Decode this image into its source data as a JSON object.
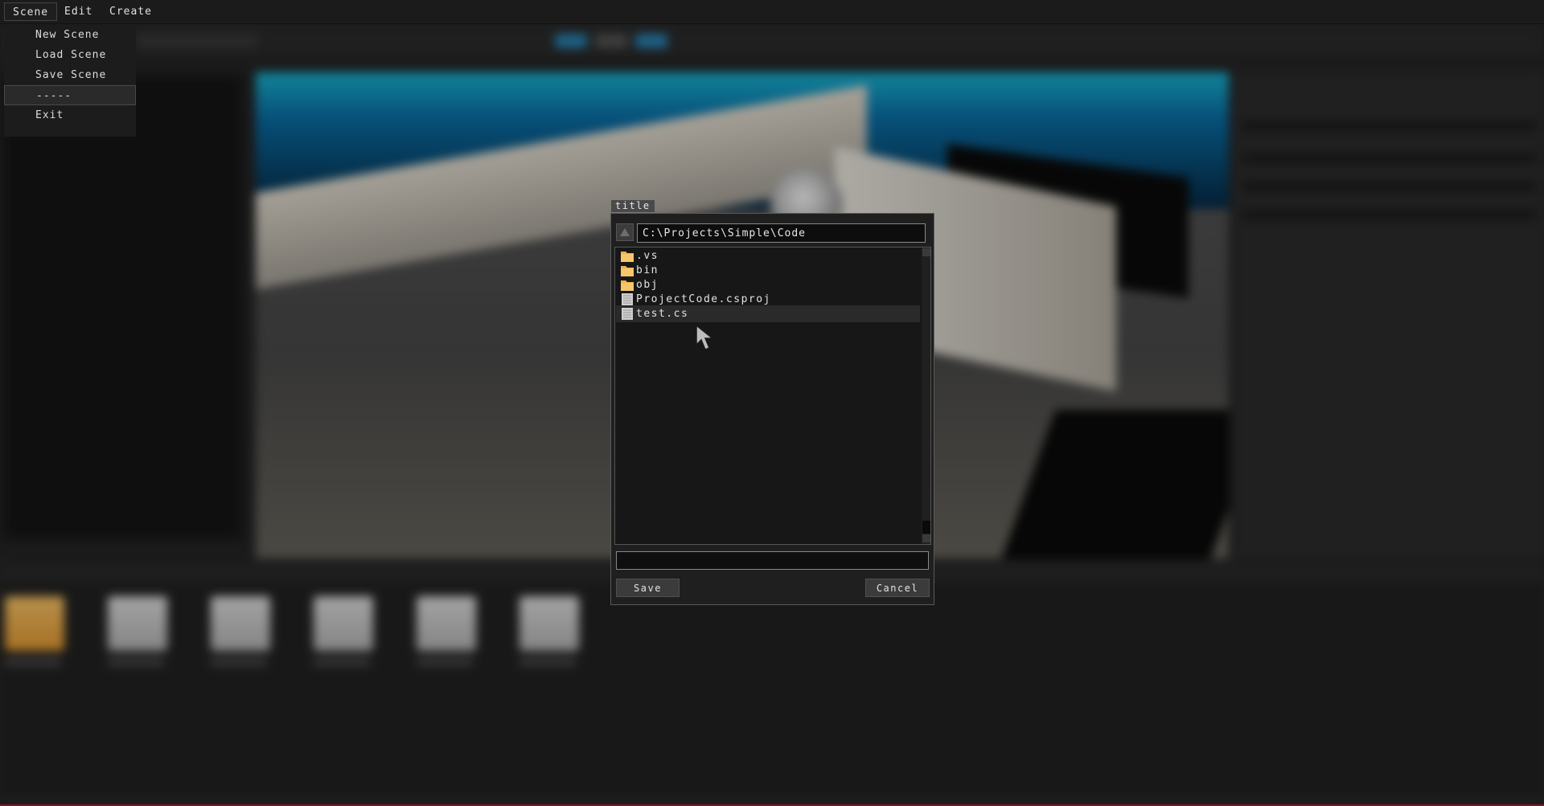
{
  "menubar": {
    "items": [
      {
        "label": "Scene"
      },
      {
        "label": "Edit"
      },
      {
        "label": "Create"
      }
    ]
  },
  "scene_menu": {
    "items": [
      {
        "label": "New Scene"
      },
      {
        "label": "Load Scene"
      },
      {
        "label": "Save Scene"
      },
      {
        "label": "-----"
      },
      {
        "label": "Exit"
      }
    ],
    "highlighted_index": 3
  },
  "dialog": {
    "title": "title",
    "path": "C:\\Projects\\Simple\\Code",
    "filename_value": "",
    "entries": [
      {
        "name": ".vs",
        "kind": "folder",
        "icon": "folder-icon"
      },
      {
        "name": "bin",
        "kind": "folder",
        "icon": "folder-icon"
      },
      {
        "name": "obj",
        "kind": "folder",
        "icon": "folder-icon"
      },
      {
        "name": "ProjectCode.csproj",
        "kind": "file",
        "icon": "file-icon"
      },
      {
        "name": "test.cs",
        "kind": "file",
        "icon": "file-icon"
      }
    ],
    "hovered_index": 4,
    "save_label": "Save",
    "cancel_label": "Cancel"
  },
  "colors": {
    "folder": "#f2b24a",
    "file": "#d0d0d0",
    "panel": "#1f1f1f"
  }
}
